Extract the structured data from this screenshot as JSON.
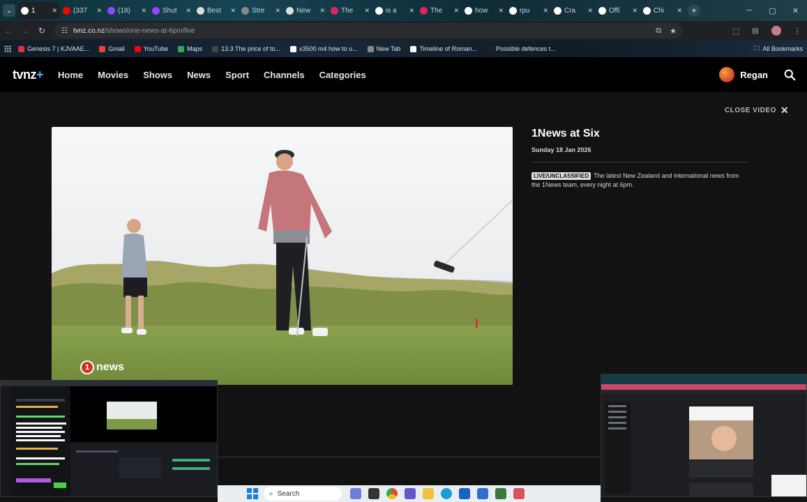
{
  "browser": {
    "tabs": [
      {
        "label": "1",
        "color": "#ffffff",
        "active": true
      },
      {
        "label": "(337",
        "color": "#ff0000"
      },
      {
        "label": "(18)",
        "color": "#9146ff"
      },
      {
        "label": "Shut",
        "color": "#9146ff"
      },
      {
        "label": "Best",
        "color": "#dddddd"
      },
      {
        "label": "Stre",
        "color": "#888888"
      },
      {
        "label": "New",
        "color": "#dddddd"
      },
      {
        "label": "The",
        "color": "#e0245e"
      },
      {
        "label": "is a",
        "color": "#ffffff"
      },
      {
        "label": "The",
        "color": "#e0245e"
      },
      {
        "label": "how",
        "color": "#ffffff"
      },
      {
        "label": "rpu",
        "color": "#ffffff"
      },
      {
        "label": "Cra",
        "color": "#ffffff"
      },
      {
        "label": "Offi",
        "color": "#ffffff"
      },
      {
        "label": "Chi",
        "color": "#ffffff"
      }
    ],
    "url_host": "tvnz.co.nz",
    "url_path": "/shows/one-news-at-6pm/live",
    "bookmarks": [
      {
        "label": "Genesis 7 | KJVAAE...",
        "color": "#d33"
      },
      {
        "label": "Gmail",
        "color": "#ea4335"
      },
      {
        "label": "YouTube",
        "color": "#ff0000"
      },
      {
        "label": "Maps",
        "color": "#34a853"
      },
      {
        "label": "13.3 The price of to...",
        "color": "#444"
      },
      {
        "label": "x3500 m4 how to u...",
        "color": "#fff"
      },
      {
        "label": "New Tab",
        "color": "#888"
      },
      {
        "label": "Timeline of Roman...",
        "color": "#fff"
      },
      {
        "label": "Possible defences t...",
        "color": "#222"
      }
    ],
    "all_bookmarks": "All Bookmarks"
  },
  "site": {
    "logo_text": "tvnz",
    "logo_plus": "+",
    "nav": [
      "Home",
      "Movies",
      "Shows",
      "News",
      "Sport",
      "Channels",
      "Categories"
    ],
    "user_name": "Regan"
  },
  "player": {
    "close_label": "CLOSE VIDEO",
    "watermark": "news",
    "watermark_digit": "1"
  },
  "info": {
    "title": "1News at Six",
    "air_date": "Sunday 18 Jan 2026",
    "badge": "LIVE/UNCLASSIFIED",
    "description": "The latest New Zealand and international news from the 1News team, every night at 6pm."
  },
  "taskbar": {
    "search_placeholder": "Search"
  }
}
